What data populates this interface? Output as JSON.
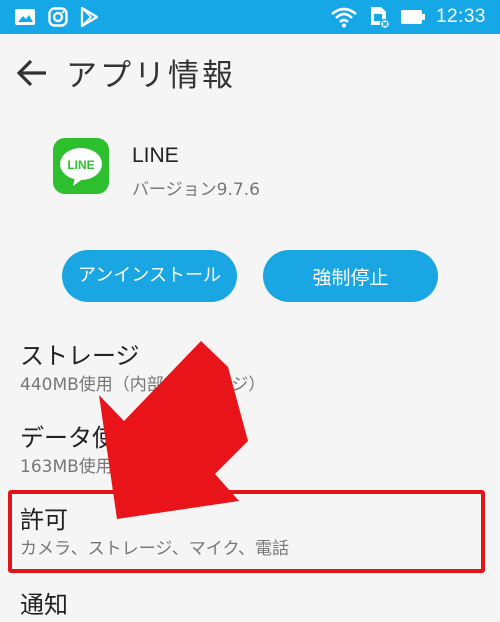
{
  "status_bar": {
    "time": "12:33",
    "left_icons": [
      "image-icon",
      "instagram-icon",
      "play-store-icon"
    ],
    "right_icons": [
      "wifi-icon",
      "sim-card-icon",
      "battery-icon"
    ]
  },
  "app_bar": {
    "title": "アプリ情報"
  },
  "app": {
    "name": "LINE",
    "version": "バージョン9.7.6",
    "icon_label": "LINE"
  },
  "buttons": {
    "uninstall": "アンインストール",
    "force_stop": "強制停止"
  },
  "settings": [
    {
      "title": "ストレージ",
      "subtitle": "440MB使用（内部ストレージ）"
    },
    {
      "title": "データ使用",
      "subtitle": "163MB使用（日以降）"
    },
    {
      "title": "許可",
      "subtitle": "カメラ、ストレージ、マイク、電話"
    },
    {
      "title": "通知",
      "subtitle": ""
    }
  ],
  "colors": {
    "accent": "#1aa6e2",
    "status_bar": "#16a8e6",
    "highlight": "#e0151a",
    "line_green": "#2ebf2f"
  }
}
